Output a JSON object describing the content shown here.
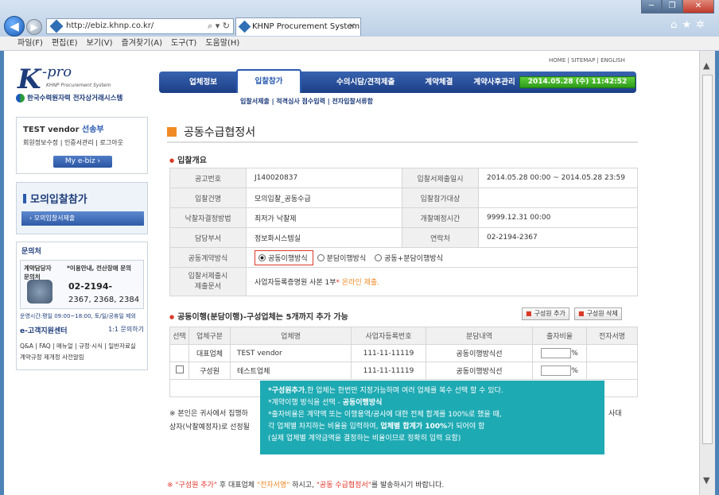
{
  "browser": {
    "url": "http://ebiz.khnp.co.kr/",
    "url_tools": "⌕ ▾ ↻",
    "tab_title": "KHNP Procurement System",
    "tab_close": "✕",
    "window_buttons": [
      "─",
      "❐",
      "✕"
    ],
    "toolbar_icons": [
      "home-icon",
      "star-icon",
      "gear-icon"
    ],
    "menu": [
      "파일(F)",
      "편집(E)",
      "보기(V)",
      "즐겨찾기(A)",
      "도구(T)",
      "도움말(H)"
    ]
  },
  "util_links": "HOME  |  SITEMAP  |  ENGLISH",
  "logo": {
    "k": "K",
    "pro": "-pro",
    "sub": "KHNP Procurement System",
    "kr": "한국수력원자력 전자상거래시스템"
  },
  "nav": {
    "items": [
      "업체정보",
      "입찰참가",
      "수의시담/견적제출",
      "계약체결",
      "계약사후관리"
    ],
    "datetime": "2014.05.28 (수)  11:42:52",
    "sub": "입찰서제출  |  적격심사 점수입력  |  전자입찰서류함"
  },
  "user": {
    "name_prefix": "TEST vendor ",
    "name_suffix": "선송부",
    "links": "회원정보수정  |  인증서관리  |  로그아웃",
    "mybiz": "My e-biz  ›"
  },
  "mock": {
    "title": "모의입찰참가",
    "sub": "› 모의입찰서제출"
  },
  "contact": {
    "title": "문의처",
    "label1": "계약담당자\n문의처",
    "label2": "*이용안내, 전산장애 문의",
    "phone1": "02-2194-",
    "phone2": "2367, 2368, 2384",
    "hours": "운영시간:평일 09:00~18:00, 토/일/공휴일 제외",
    "center": "e-고객지원센터",
    "center_link": "1:1 문의하기",
    "center_links": "Q&A | FAQ | 메뉴얼 | 규정·시식 | 일반자료실\n계약규정 제개정 사전알림"
  },
  "page": {
    "title": "공동수급협정서",
    "section1": "입찰개요",
    "info": {
      "notice_label": "공고번호",
      "notice_value": "J140020837",
      "period_label": "입찰서제출일시",
      "period_value": "2014.05.28 00:00 ~ 2014.05.28 23:59",
      "bid_label": "입찰건명",
      "bid_value": "모의입찰_공동수급",
      "target_label": "입찰참가대상",
      "target_value": "",
      "method_label": "낙찰자결정방법",
      "method_value": "최저가 낙찰제",
      "open_label": "개찰예정시간",
      "open_value": "9999.12.31 00:00",
      "dept_label": "담당부서",
      "dept_value": "정보화시스템실",
      "contact_label": "연락처",
      "contact_value": "02-2194-2367",
      "joint_label": "공동계약방식",
      "joint_options": [
        "공동이행방식",
        "분담이행방식",
        "공동+분담이행방식"
      ],
      "docs_label": "입찰서제출시\n제출문서",
      "docs_value": "사업자등록증명원 사본 1부",
      "docs_star": "*",
      "docs_note": "온라인 제출."
    },
    "section2": "공동이행(분담이행)-구성업체는 5개까지 추가 가능",
    "add_member": "구성원 추가",
    "del_member": "구성원 삭제",
    "columns": [
      "선택",
      "업체구분",
      "업체명",
      "사업자등록번호",
      "분담내역",
      "출자비율",
      "전자서명"
    ],
    "rows": [
      {
        "type": "대표업체",
        "name": "TEST vendor",
        "reg": "111-11-11119",
        "share": "공동이행방식선",
        "pct_unit": "%"
      },
      {
        "type": "구성원",
        "name": "테스트업체",
        "reg": "111-11-11119",
        "share": "공동이행방식선",
        "pct_unit": "%"
      }
    ],
    "note_line1": "※ 본인은 귀사에서 집행하",
    "note_line1_end": "사대",
    "note_line2": "상자(낙찰예정자)로 선정될",
    "tip": {
      "l1_bold": "*구성원추가",
      "l1": ",한 업체는 한번만 지정가능하며 여러 업체를 복수 선택 할 수 있다.",
      "l2a": "*계약이행 방식을 선택 - ",
      "l2b": "공동이행방식",
      "l3": "*출자비율은 계약액 또는 이행용역/공사에 대한 전체 합계를 100%로 했을 때,",
      "l4a": " 각 업체별 차지하는 비율을 입력하여, ",
      "l4b": "업체별 합계가 100%",
      "l4c": "가 되어야 함",
      "l5": "(실제 업체별 계약금액을 결정하는 비율이므로 정확히 입력 요함)"
    },
    "footer": {
      "p1": "※ \"구성원 추가\"",
      "p2": " 후 대표업체 ",
      "p3": "\"전자서명\"",
      "p4": " 하시고, ",
      "p5": "\"공동 수급협정서\"",
      "p6": "를 발송하시기 바랍니다."
    }
  }
}
